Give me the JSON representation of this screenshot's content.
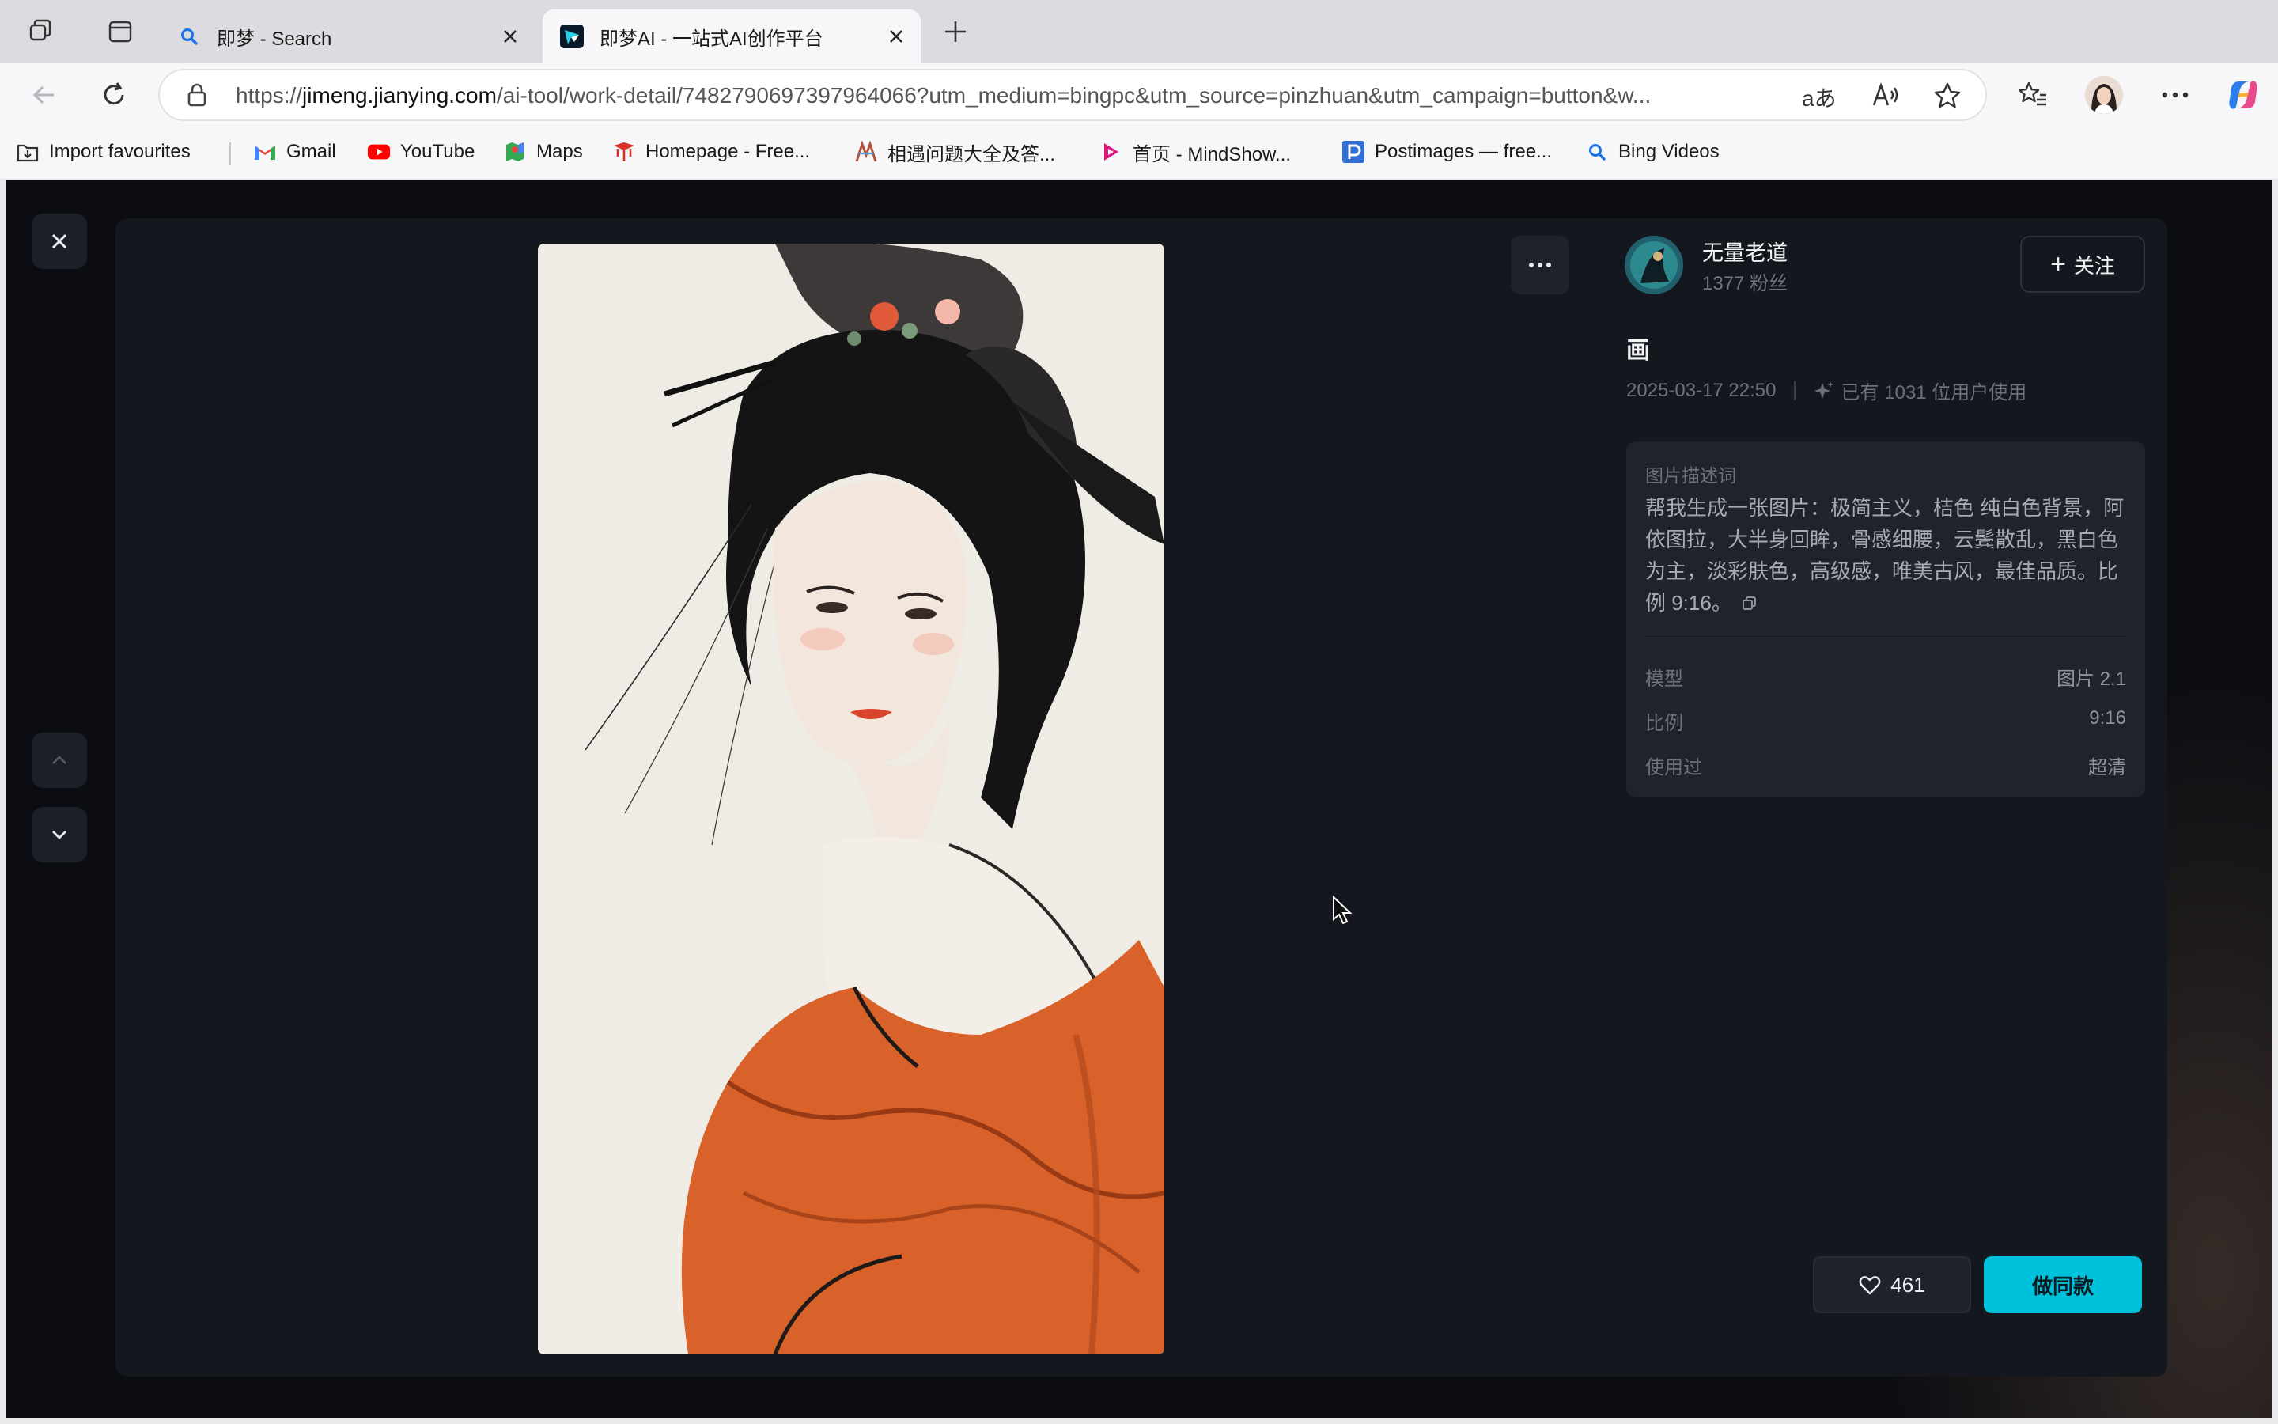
{
  "browser": {
    "tabs": [
      {
        "title": "即梦 - Search",
        "active": false
      },
      {
        "title": "即梦AI - 一站式AI创作平台",
        "active": true
      }
    ],
    "url": {
      "prefix": "https://",
      "domain": "jimeng.jianying.com",
      "path": "/ai-tool/work-detail/7482790697397964066?utm_medium=bingpc&utm_source=pinzhuan&utm_campaign=button&w..."
    },
    "bookmarks": [
      {
        "label": "Import favourites",
        "icon": "import-icon"
      },
      {
        "label": "Gmail",
        "icon": "gmail-icon"
      },
      {
        "label": "YouTube",
        "icon": "youtube-icon"
      },
      {
        "label": "Maps",
        "icon": "maps-icon"
      },
      {
        "label": "Homepage - Free...",
        "icon": "homepage-icon"
      },
      {
        "label": "相遇问题大全及答...",
        "icon": "site-icon"
      },
      {
        "label": "首页 - MindShow...",
        "icon": "mindshow-icon"
      },
      {
        "label": "Postimages — free...",
        "icon": "postimages-icon"
      },
      {
        "label": "Bing Videos",
        "icon": "bing-search-icon"
      }
    ],
    "accent": "#00c1db"
  },
  "work": {
    "author": {
      "name": "无量老道",
      "fans": "1377 粉丝"
    },
    "follow_label": "关注",
    "title": "画",
    "date": "2025-03-17 22:50",
    "usage": "已有 1031 位用户使用",
    "prompt_label": "图片描述词",
    "prompt": "帮我生成一张图片：极简主义，桔色 纯白色背景，阿依图拉，大半身回眸，骨感细腰，云鬓散乱，黑白色为主，淡彩肤色，高级感，唯美古风，最佳品质。比例 9:16。",
    "params": [
      {
        "key": "模型",
        "value": "图片 2.1"
      },
      {
        "key": "比例",
        "value": "9:16"
      },
      {
        "key": "使用过",
        "value": "超清"
      }
    ],
    "likes": "461",
    "remix_label": "做同款"
  }
}
